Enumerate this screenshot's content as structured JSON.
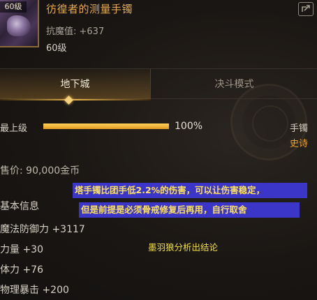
{
  "item": {
    "icon_level_badge": "60级",
    "name": "彷徨者的测量手镯",
    "resist": "抗魔值: +637",
    "level": "60级",
    "slot": "手镯",
    "rarity": "史诗",
    "rarity_color": "#f0a530",
    "price": "售价: 90,000金币",
    "durability_label": "最上级",
    "durability_value": "100%",
    "durability_fraction": 1.0
  },
  "tabs": [
    {
      "label": "地下城",
      "active": true
    },
    {
      "label": "决斗模式",
      "active": false
    }
  ],
  "stats": {
    "title": "基本信息",
    "lines": [
      "魔法防御力 +3117",
      "力量 +30",
      "体力 +76",
      "物理暴击 +200"
    ]
  },
  "overlay": {
    "line1": "塔手镯比团手低2.2%的伤害，可以让伤害稳定，",
    "line2": "但是前提是必须骨戒修复后再用，自行取舍",
    "credit": "墨羽狼分析出结论"
  },
  "icons": {
    "share": "share-icon",
    "item": "bracelet-item-icon",
    "emblem": "watermark-emblem"
  },
  "colors": {
    "item_name": "#e5a84a",
    "accent_gold": "#e6b24a",
    "note_bg": "#3c36c8",
    "note_text": "#ffe35a",
    "credit_text": "#f0e040"
  }
}
